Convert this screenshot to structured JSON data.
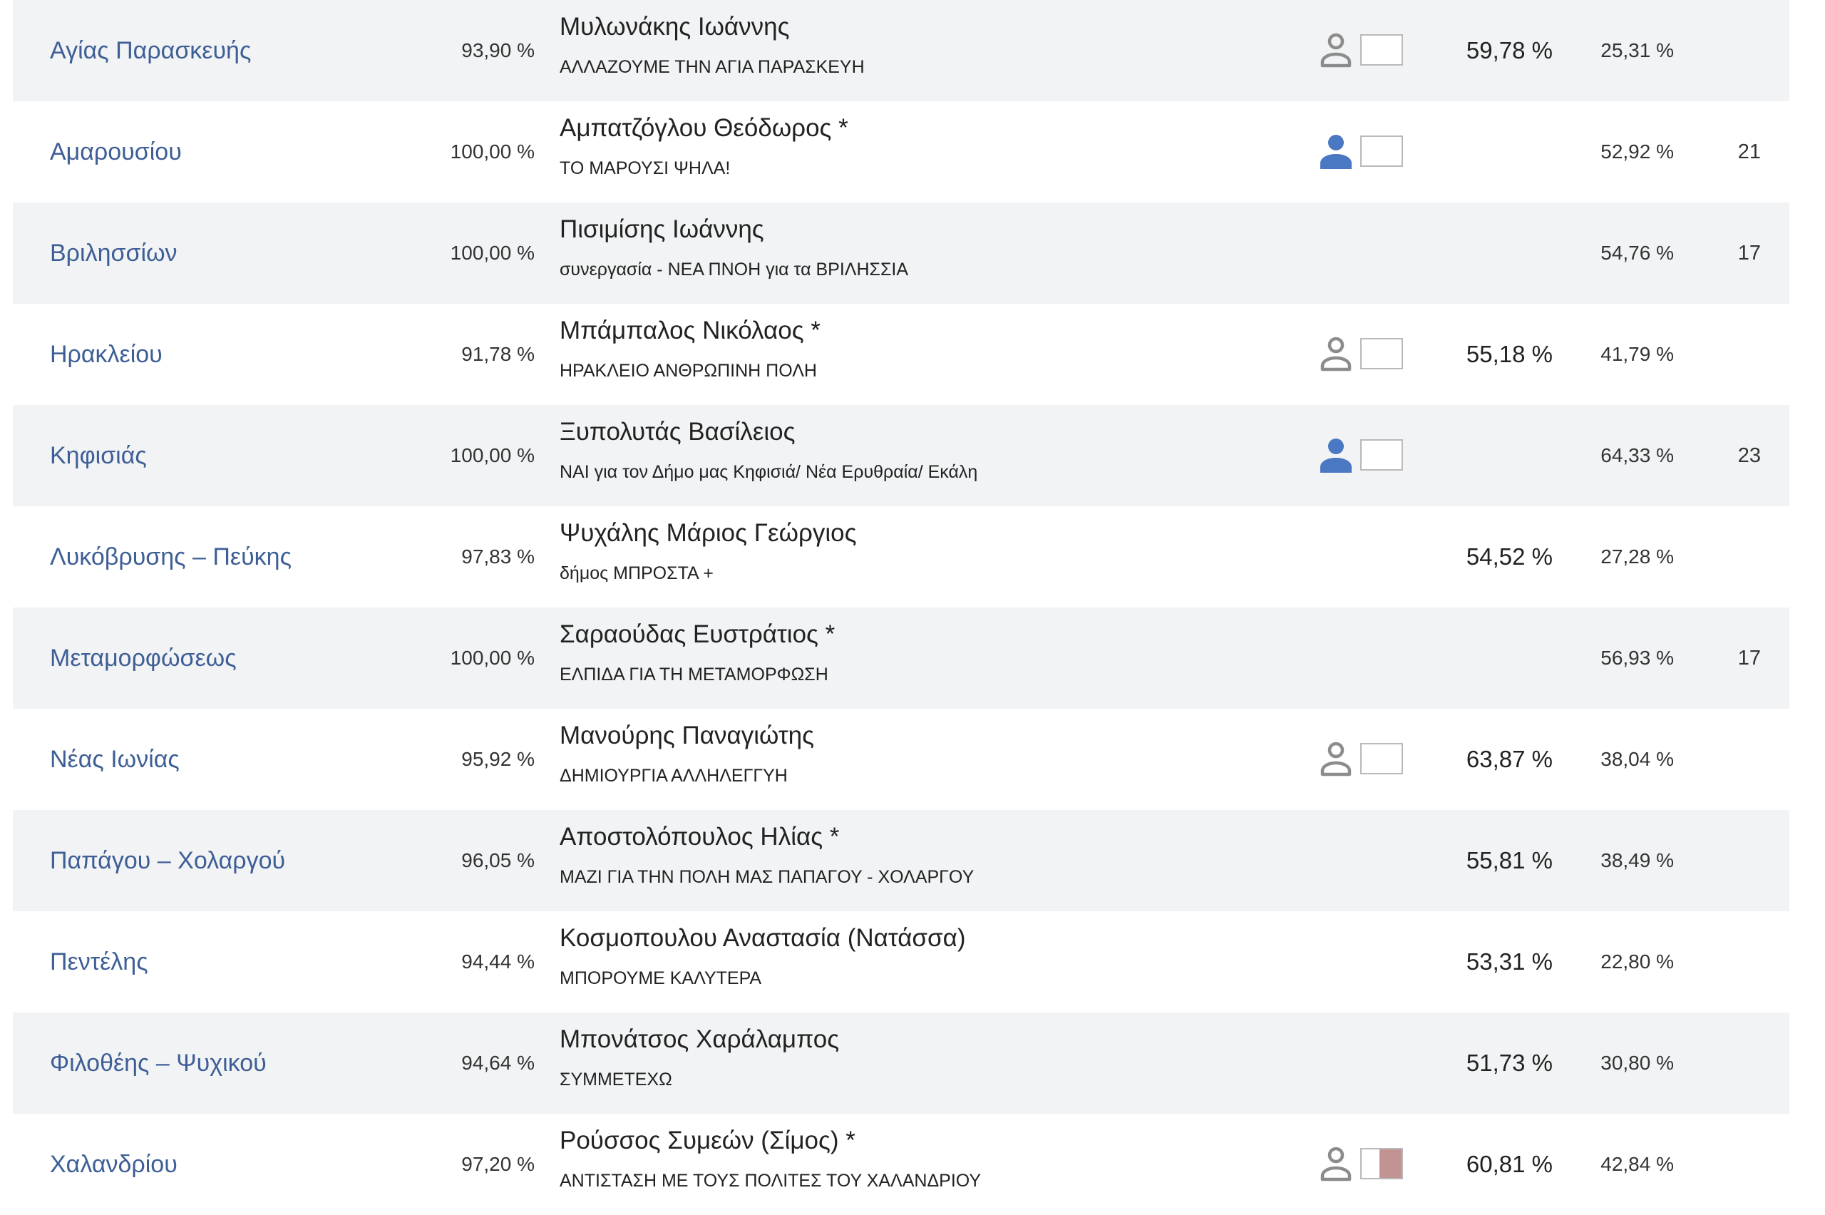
{
  "colors": {
    "link": "#3e5f96",
    "row_shade": "#f2f3f4",
    "icon_elected": "#4a78c2",
    "icon_runoff": "#8c8c8c",
    "runoff_fill": "#c29393"
  },
  "rows": [
    {
      "municipality": "Αγίας Παρασκευής",
      "counted": "93,90 %",
      "candidate": "Μυλωνάκης Ιωάννης",
      "party": "ΑΛΛΑΖΟΥΜΕ ΤΗΝ ΑΓΙΑ ΠΑΡΑΣΚΕΥΗ",
      "icon": "person-outline-icon",
      "round2": "59,78 %",
      "round1": "25,31 %",
      "seats": ""
    },
    {
      "municipality": "Αμαρουσίου",
      "counted": "100,00 %",
      "candidate": "Αμπατζόγλου Θεόδωρος *",
      "party": "ΤΟ ΜΑΡΟΥΣΙ ΨΗΛΑ!",
      "icon": "person-filled-icon",
      "round2": "",
      "round1": "52,92 %",
      "seats": "21"
    },
    {
      "municipality": "Βριλησσίων",
      "counted": "100,00 %",
      "candidate": "Πισιμίσης Ιωάννης",
      "party": "συνεργασία - ΝΕΑ ΠΝΟΗ για τα ΒΡΙΛΗΣΣΙΑ",
      "icon": "",
      "round2": "",
      "round1": "54,76 %",
      "seats": "17"
    },
    {
      "municipality": "Ηρακλείου",
      "counted": "91,78 %",
      "candidate": "Μπάμπαλος Νικόλαος *",
      "party": "ΗΡΑΚΛΕΙΟ ΑΝΘΡΩΠΙΝΗ ΠΟΛΗ",
      "icon": "person-outline-icon",
      "round2": "55,18 %",
      "round1": "41,79 %",
      "seats": ""
    },
    {
      "municipality": "Κηφισιάς",
      "counted": "100,00 %",
      "candidate": "Ξυπολυτάς Βασίλειος",
      "party": "ΝΑΙ για τον Δήμο μας Κηφισιά/ Νέα Ερυθραία/ Εκάλη",
      "icon": "person-filled-icon",
      "round2": "",
      "round1": "64,33 %",
      "seats": "23"
    },
    {
      "municipality": "Λυκόβρυσης – Πεύκης",
      "counted": "97,83 %",
      "candidate": "Ψυχάλης Μάριος Γεώργιος",
      "party": "δήμος ΜΠΡΟΣΤΑ +",
      "icon": "",
      "round2": "54,52 %",
      "round1": "27,28 %",
      "seats": ""
    },
    {
      "municipality": "Μεταμορφώσεως",
      "counted": "100,00 %",
      "candidate": "Σαραούδας Ευστράτιος *",
      "party": "ΕΛΠΙΔΑ ΓΙΑ ΤΗ ΜΕΤΑΜΟΡΦΩΣΗ",
      "icon": "",
      "round2": "",
      "round1": "56,93 %",
      "seats": "17"
    },
    {
      "municipality": "Νέας Ιωνίας",
      "counted": "95,92 %",
      "candidate": "Μανούρης Παναγιώτης",
      "party": "ΔΗΜΙΟΥΡΓΙΑ ΑΛΛΗΛΕΓΓΥΗ",
      "icon": "person-outline-icon",
      "round2": "63,87 %",
      "round1": "38,04 %",
      "seats": ""
    },
    {
      "municipality": "Παπάγου – Χολαργού",
      "counted": "96,05 %",
      "candidate": "Αποστολόπουλος Ηλίας  *",
      "party": "ΜΑΖΙ ΓΙΑ ΤΗΝ ΠΟΛΗ ΜΑΣ ΠΑΠΑΓΟΥ - ΧΟΛΑΡΓΟΥ",
      "icon": "",
      "round2": "55,81 %",
      "round1": "38,49 %",
      "seats": ""
    },
    {
      "municipality": "Πεντέλης",
      "counted": "94,44 %",
      "candidate": "Κοσμοπουλου Αναστασία (Νατάσσα)",
      "party": "ΜΠΟΡΟΥΜΕ ΚΑΛΥΤΕΡΑ",
      "icon": "",
      "round2": "53,31 %",
      "round1": "22,80 %",
      "seats": ""
    },
    {
      "municipality": "Φιλοθέης – Ψυχικού",
      "counted": "94,64 %",
      "candidate": "Μπονάτσος Χαράλαμπος",
      "party": "ΣΥΜΜΕΤΕΧΩ",
      "icon": "",
      "round2": "51,73 %",
      "round1": "30,80 %",
      "seats": ""
    },
    {
      "municipality": "Χαλανδρίου",
      "counted": "97,20 %",
      "candidate": "Ρούσσος Συμεών (Σίμος) *",
      "party": "ΑΝΤΙΣΤΑΣΗ ΜΕ ΤΟΥΣ ΠΟΛΙΤΕΣ ΤΟΥ ΧΑΛΑΝΔΡΙΟΥ",
      "icon": "person-outline-icon",
      "round2": "60,81 %",
      "round1": "42,84 %",
      "seats": "",
      "box_fill": 0.55
    }
  ]
}
